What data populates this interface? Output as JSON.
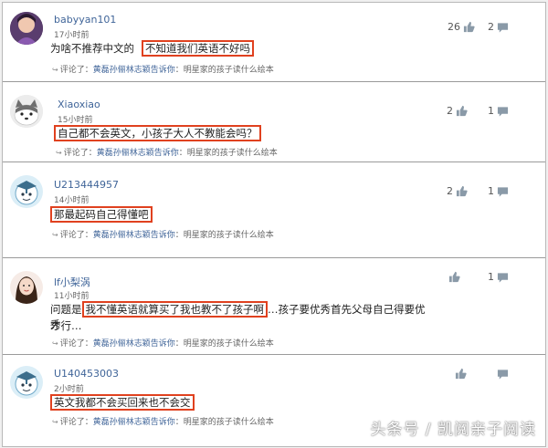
{
  "comments": [
    {
      "username": "babyyan101",
      "time": "17小时前",
      "text_pre": "为啥不推荐中文的",
      "text_highlight": "不知道我们英语不好吗",
      "text_post": "",
      "reply_prefix": "评论了：",
      "reply_user": "黄磊孙俪林志颖告诉你",
      "reply_text": "：明星家的孩子读什么绘本",
      "likes": "26",
      "replies": "2"
    },
    {
      "username": "Xiaoxiao",
      "time": "15小时前",
      "text_pre": "",
      "text_highlight": "自己都不会英文，小孩子大人不教能会吗？",
      "text_post": "",
      "reply_prefix": "评论了：",
      "reply_user": "黄磊孙俪林志颖告诉你",
      "reply_text": "：明星家的孩子读什么绘本",
      "likes": "2",
      "replies": "1"
    },
    {
      "username": "U213444957",
      "time": "14小时前",
      "text_pre": "",
      "text_highlight": "那最起码自己得懂吧",
      "text_post": "",
      "reply_prefix": "评论了：",
      "reply_user": "黄磊孙俪林志颖告诉你",
      "reply_text": "：明星家的孩子读什么绘本",
      "likes": "2",
      "replies": "1"
    },
    {
      "username": "lf小梨涡",
      "time": "11小时前",
      "text_pre": "问题是",
      "text_highlight": "我不懂英语就算买了我也教不了孩子啊",
      "text_post": "…孩子要优秀首先父母自己得要优秀",
      "text_line2": "才行…",
      "reply_prefix": "评论了：",
      "reply_user": "黄磊孙俪林志颖告诉你",
      "reply_text": "：明星家的孩子读什么绘本",
      "likes": "",
      "replies": "1"
    },
    {
      "username": "U140453003",
      "time": "2小时前",
      "text_pre": "",
      "text_highlight": "英文我都不会买回来也不会交",
      "text_post": "",
      "reply_prefix": "评论了：",
      "reply_user": "黄磊孙俪林志颖告诉你",
      "reply_text": "：明星家的孩子读什么绘本",
      "likes": "",
      "replies": ""
    }
  ],
  "watermark": "头条号 / 凯阅亲子阅读",
  "colors": {
    "highlight_border": "#e0411f",
    "username": "#406599",
    "divider": "#9a9a9a"
  },
  "icons": {
    "like": "thumb-up-icon",
    "reply": "speech-bubble-icon"
  }
}
